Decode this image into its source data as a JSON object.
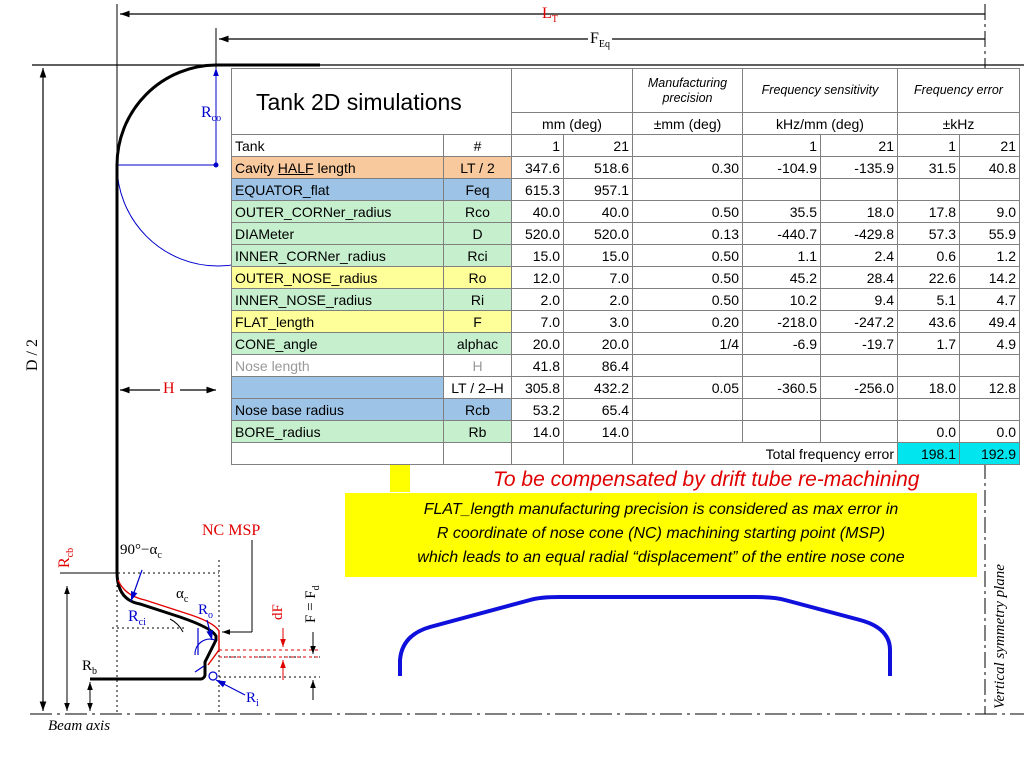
{
  "dimensions": {
    "lt": "L",
    "lt_sub": "T",
    "feq": "F",
    "feq_sub": "Eq",
    "rco": "R",
    "rco_sub": "co",
    "d2": "D / 2",
    "h": "H",
    "rcb": "R",
    "rcb_sub": "cb",
    "angle": "90°−α",
    "angle_sub": "c",
    "alpha": "α",
    "alpha_sub": "c",
    "ro": "R",
    "ro_sub": "o",
    "rci": "R",
    "rci_sub": "ci",
    "rb": "R",
    "rb_sub": "b",
    "ri": "R",
    "ri_sub": "i",
    "nc_msp": "NC MSP",
    "df": "dF",
    "f_fd": "F = F",
    "f_fd_sub": "d",
    "beam_axis": "Beam axis",
    "sym_plane": "Vertical symmetry plane"
  },
  "table": {
    "title": "Tank 2D simulations",
    "hdr_manuf": "Manufacturing precision",
    "hdr_sens": "Frequency sensitivity",
    "hdr_err": "Frequency error",
    "unit_mm": "mm (deg)",
    "unit_pm_mm": "±mm (deg)",
    "unit_khz_mm": "kHz/mm (deg)",
    "unit_khz": "±kHz",
    "rows": [
      {
        "label": "Tank",
        "sym": "#",
        "v1": "1",
        "v2": "21",
        "p": "",
        "s1": "1",
        "s2": "21",
        "e1": "1",
        "e2": "21"
      },
      {
        "label_pre": "Cavity ",
        "label_u": "HALF",
        "label_post": " length",
        "sym": "LT / 2",
        "v1": "347.6",
        "v2": "518.6",
        "p": "0.30",
        "s1": "-104.9",
        "s2": "-135.9",
        "e1": "31.5",
        "e2": "40.8"
      },
      {
        "label": "EQUATOR_flat",
        "sym": "Feq",
        "v1": "615.3",
        "v2": "957.1",
        "p": "",
        "s1": "",
        "s2": "",
        "e1": "",
        "e2": ""
      },
      {
        "label": "OUTER_CORNer_radius",
        "sym": "Rco",
        "v1": "40.0",
        "v2": "40.0",
        "p": "0.50",
        "s1": "35.5",
        "s2": "18.0",
        "e1": "17.8",
        "e2": "9.0"
      },
      {
        "label": "DIAMeter",
        "sym": "D",
        "v1": "520.0",
        "v2": "520.0",
        "p": "0.13",
        "s1": "-440.7",
        "s2": "-429.8",
        "e1": "57.3",
        "e2": "55.9"
      },
      {
        "label": "INNER_CORNer_radius",
        "sym": "Rci",
        "v1": "15.0",
        "v2": "15.0",
        "p": "0.50",
        "s1": "1.1",
        "s2": "2.4",
        "e1": "0.6",
        "e2": "1.2"
      },
      {
        "label": "OUTER_NOSE_radius",
        "sym": "Ro",
        "v1": "12.0",
        "v2": "7.0",
        "p": "0.50",
        "s1": "45.2",
        "s2": "28.4",
        "e1": "22.6",
        "e2": "14.2"
      },
      {
        "label": "INNER_NOSE_radius",
        "sym": "Ri",
        "v1": "2.0",
        "v2": "2.0",
        "p": "0.50",
        "s1": "10.2",
        "s2": "9.4",
        "e1": "5.1",
        "e2": "4.7"
      },
      {
        "label": "FLAT_length",
        "sym": "F",
        "v1": "7.0",
        "v2": "3.0",
        "p": "0.20",
        "s1": "-218.0",
        "s2": "-247.2",
        "e1": "43.6",
        "e2": "49.4"
      },
      {
        "label": "CONE_angle",
        "sym": "alphac",
        "v1": "20.0",
        "v2": "20.0",
        "p": "1/4",
        "s1": "-6.9",
        "s2": "-19.7",
        "e1": "1.7",
        "e2": "4.9"
      },
      {
        "label": "Nose length",
        "sym": "H",
        "v1": "41.8",
        "v2": "86.4",
        "p": "",
        "s1": "",
        "s2": "",
        "e1": "",
        "e2": ""
      },
      {
        "label": "",
        "sym": "LT / 2–H",
        "v1": "305.8",
        "v2": "432.2",
        "p": "0.05",
        "s1": "-360.5",
        "s2": "-256.0",
        "e1": "18.0",
        "e2": "12.8"
      },
      {
        "label": "Nose base radius",
        "sym": "Rcb",
        "v1": "53.2",
        "v2": "65.4",
        "p": "",
        "s1": "",
        "s2": "",
        "e1": "",
        "e2": ""
      },
      {
        "label": "BORE_radius",
        "sym": "Rb",
        "v1": "14.0",
        "v2": "14.0",
        "p": "",
        "s1": "",
        "s2": "",
        "e1": "0.0",
        "e2": "0.0"
      }
    ],
    "total_label": "Total frequency error",
    "total1": "198.1",
    "total2": "192.9"
  },
  "compensate_text": "To be compensated by drift tube re-machining",
  "note_lines": [
    "FLAT_length manufacturing precision is considered as max error in",
    "R coordinate of nose cone (NC) machining starting point (MSP)",
    "which leads to an equal radial “displacement” of the entire nose cone"
  ],
  "colors": {
    "profile": "#000000",
    "construction": "#0000cc",
    "highlight": "#e00000",
    "arrow": "#ffff00",
    "drift_tube": "#1010dd"
  }
}
